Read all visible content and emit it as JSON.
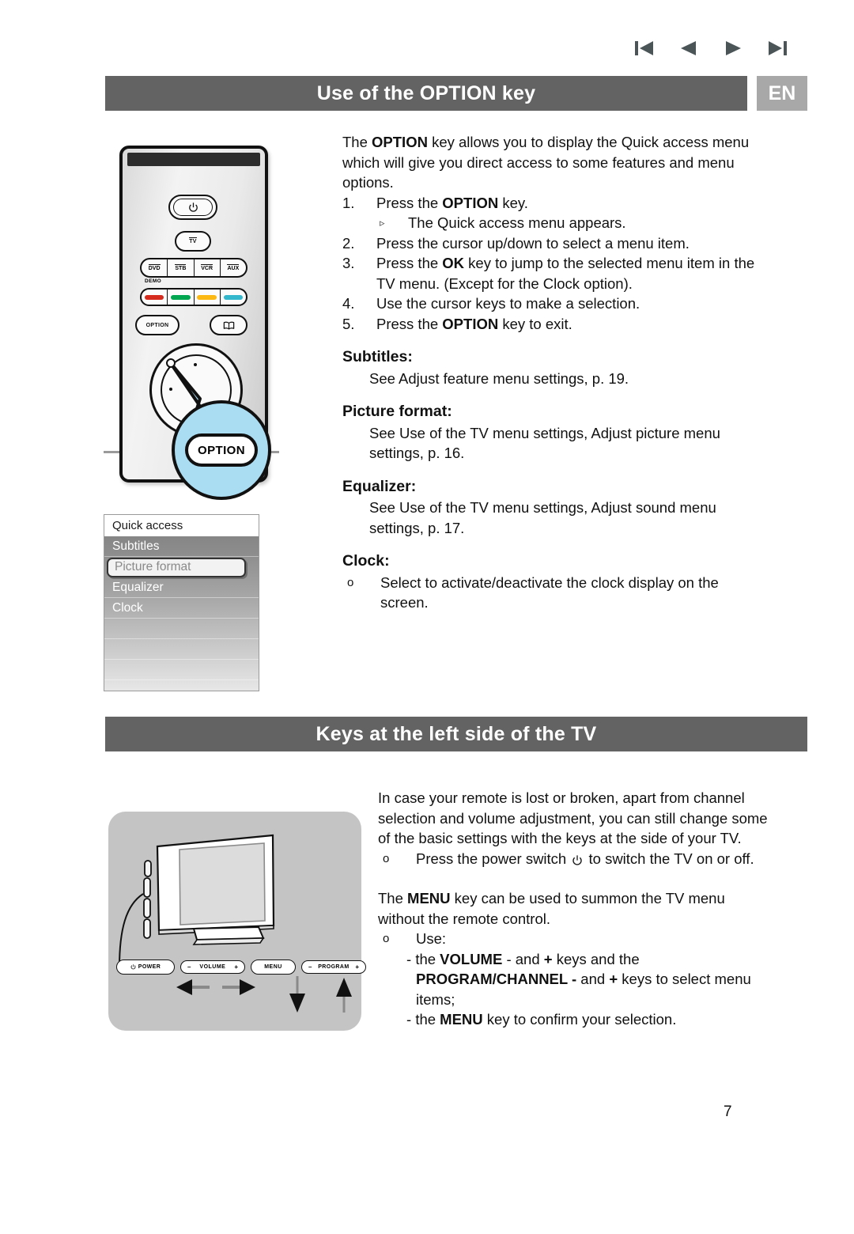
{
  "nav": {
    "items": [
      {
        "name": "first-page-icon",
        "glyph": "first"
      },
      {
        "name": "previous-page-icon",
        "glyph": "prev"
      },
      {
        "name": "next-page-icon",
        "glyph": "next"
      },
      {
        "name": "last-page-icon",
        "glyph": "last"
      }
    ],
    "color": "#4b5557"
  },
  "colors": {
    "header_bar": "#636363",
    "lang_badge": "#a8a8a8",
    "callout_fill": "#aadcf2",
    "tv_panel": "#c4c4c4",
    "remote_color_keys": [
      "#d52b1e",
      "#00a650",
      "#fdb913",
      "#32b7cc"
    ]
  },
  "section_option": {
    "title": "Use of the OPTION key",
    "language_badge": "EN",
    "intro": {
      "lead": "The ",
      "bold1": "OPTION",
      "rest": " key allows you to display the Quick access menu which will give you direct access to some features and menu options."
    },
    "steps": [
      {
        "num": "1.",
        "pre": "Press the ",
        "bold": "OPTION",
        "post": " key."
      },
      {
        "num": "2.",
        "pre": "Press the cursor up/down to select a menu item.",
        "bold": "",
        "post": ""
      },
      {
        "num": "3.",
        "pre": "Press the ",
        "bold": "OK",
        "post": " key to jump to the selected menu item in the TV menu. (Except for the Clock option)."
      },
      {
        "num": "4.",
        "pre": "Use the cursor keys to make a selection.",
        "bold": "",
        "post": ""
      },
      {
        "num": "5.",
        "pre": "Press the ",
        "bold": "OPTION",
        "post": " key to exit."
      }
    ],
    "step1_note": "The Quick access menu appears.",
    "step1_note_marker": "▹",
    "subsections": [
      {
        "heading": "Subtitles:",
        "body": "See Adjust feature menu settings, p. 19.",
        "bullet": false
      },
      {
        "heading": "Picture format:",
        "body": "See Use of the TV menu settings, Adjust picture menu settings, p. 16.",
        "bullet": false
      },
      {
        "heading": "Equalizer:",
        "body": "See Use of the TV menu settings, Adjust sound menu settings, p. 17.",
        "bullet": false
      },
      {
        "heading": "Clock:",
        "body": "Select to activate/deactivate the clock display on the screen.",
        "bullet": true,
        "bullet_marker": "o"
      }
    ]
  },
  "remote": {
    "power_key": "power-icon",
    "tv_key": "TV",
    "source_keys": [
      "DVD",
      "STB",
      "VCR",
      "AUX"
    ],
    "demo_label": "DEMO",
    "option_key": "OPTION",
    "guide_key": "book-icon",
    "callout_label": "OPTION"
  },
  "quick_access_menu": {
    "title": "Quick access",
    "items": [
      {
        "label": "Subtitles",
        "selected": false
      },
      {
        "label": "Picture format",
        "selected": true
      },
      {
        "label": "Equalizer",
        "selected": false
      },
      {
        "label": "Clock",
        "selected": false
      }
    ],
    "empty_rows": 4
  },
  "section_keys": {
    "title": "Keys at the left side of the TV",
    "para1": "In case your remote is lost or broken, apart from channel selection and volume adjustment, you can still change some of the basic settings with the keys at the side of your TV.",
    "bullet1_marker": "o",
    "bullet1_pre": "Press the power switch ",
    "bullet1_post": " to switch the TV on or off.",
    "para2_pre": "The ",
    "para2_bold": "MENU",
    "para2_post": " key can be used to summon the TV menu without the remote control.",
    "bullet2_marker": "o",
    "bullet2_label": "Use:",
    "dash_lines": [
      {
        "dash": "- ",
        "seg": [
          {
            "t": "the ",
            "b": false
          },
          {
            "t": "VOLUME",
            "b": true
          },
          {
            "t": " - and ",
            "b": false
          },
          {
            "t": "+",
            "b": true
          },
          {
            "t": " keys and the",
            "b": false
          }
        ]
      },
      {
        "dash": "",
        "seg": [
          {
            "t": "PROGRAM/CHANNEL -",
            "b": true
          },
          {
            "t": " and ",
            "b": false
          },
          {
            "t": "+",
            "b": true
          },
          {
            "t": "  keys to select menu",
            "b": false
          }
        ]
      },
      {
        "dash": "",
        "seg": [
          {
            "t": "items;",
            "b": false
          }
        ]
      },
      {
        "dash": "- ",
        "seg": [
          {
            "t": "the ",
            "b": false
          },
          {
            "t": "MENU",
            "b": true
          },
          {
            "t": " key to confirm your selection.",
            "b": false
          }
        ]
      }
    ]
  },
  "tv_figure": {
    "buttons": [
      {
        "name": "power-button",
        "label": "POWER",
        "has_power_icon": true,
        "left": "",
        "right": ""
      },
      {
        "name": "volume-button",
        "label": "VOLUME",
        "has_power_icon": false,
        "left": "–",
        "right": "+"
      },
      {
        "name": "menu-button",
        "label": "MENU",
        "has_power_icon": false,
        "left": "",
        "right": ""
      },
      {
        "name": "program-button",
        "label": "PROGRAM",
        "has_power_icon": false,
        "left": "–",
        "right": "+"
      }
    ]
  },
  "footer": {
    "page_number": "7"
  }
}
